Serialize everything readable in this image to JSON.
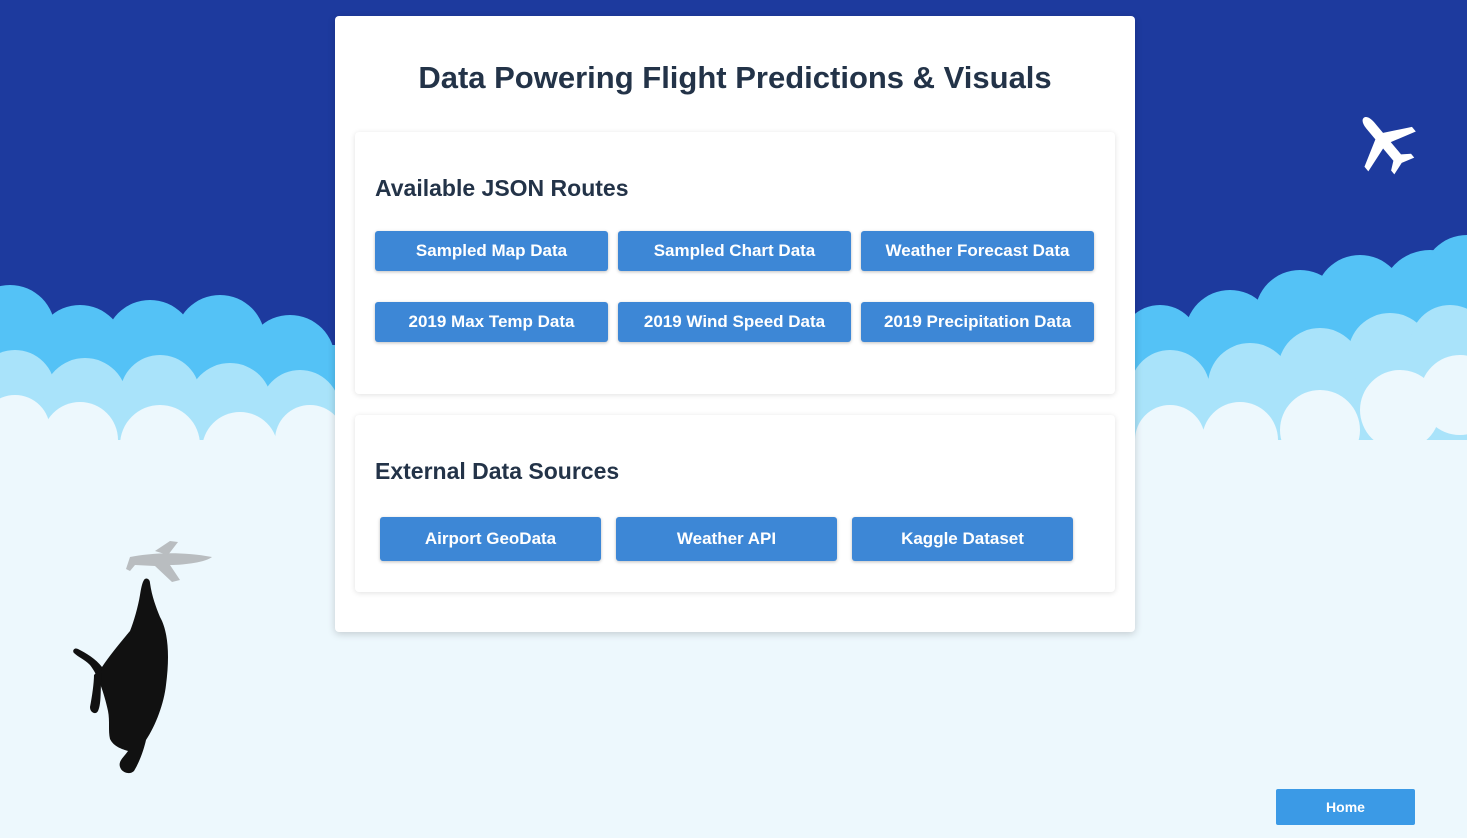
{
  "page": {
    "title": "Data Powering Flight Predictions & Visuals"
  },
  "routes": {
    "heading": "Available JSON Routes",
    "buttons": [
      "Sampled Map Data",
      "Sampled Chart Data",
      "Weather Forecast Data",
      "2019 Max Temp Data",
      "2019 Wind Speed Data",
      "2019 Precipitation Data"
    ]
  },
  "external": {
    "heading": "External Data Sources",
    "buttons": [
      "Airport GeoData",
      "Weather API",
      "Kaggle Dataset"
    ]
  },
  "nav": {
    "home_label": "Home"
  },
  "colors": {
    "sky": "#1d3a9e",
    "cloud_far": "#54c2f6",
    "cloud_mid": "#a9e3fa",
    "cloud_near": "#edf8fd",
    "button": "#3d87d6",
    "home_button": "#3b9ae6",
    "heading_text": "#233348"
  },
  "icons": {
    "top_right": "airplane-icon",
    "bottom_left_plane": "airplane-icon",
    "bottom_left_figure": "cat-silhouette-icon"
  }
}
